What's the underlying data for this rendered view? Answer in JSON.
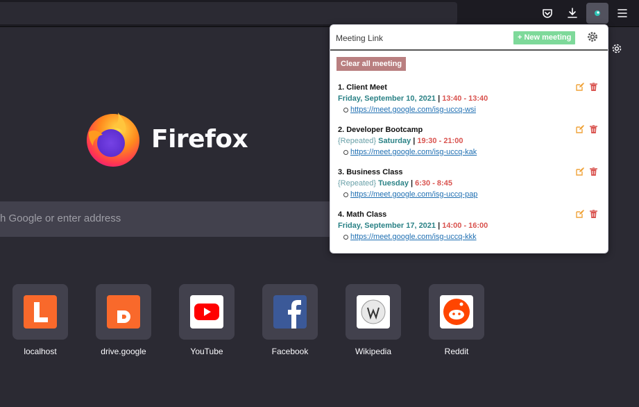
{
  "browser": {
    "search_placeholder": "h Google or enter address",
    "brand": "Firefox"
  },
  "tiles": [
    {
      "label": "localhost",
      "icon": "localhost-icon",
      "letter": "L",
      "color": "#f9692b"
    },
    {
      "label": "drive.google",
      "icon": "drive-google-icon",
      "letter": "D",
      "color": "#f9692b"
    },
    {
      "label": "YouTube",
      "icon": "youtube-icon",
      "color": "#ff0000"
    },
    {
      "label": "Facebook",
      "icon": "facebook-icon",
      "color": "#3b5998"
    },
    {
      "label": "Wikipedia",
      "icon": "wikipedia-icon",
      "color": "#eeeeee"
    },
    {
      "label": "Reddit",
      "icon": "reddit-icon",
      "color": "#ff4500"
    }
  ],
  "popup": {
    "title": "Meeting Link",
    "new_button": "+ New meeting",
    "clear_button": "Clear all meeting",
    "meetings": [
      {
        "title": "1. Client Meet",
        "repeated": "",
        "day": "Friday, September 10, 2021",
        "sep": "|",
        "time": "13:40 - 13:40",
        "link": "https://meet.google.com/isg-uccq-wsi"
      },
      {
        "title": "2. Developer Bootcamp",
        "repeated": "{Repeated}",
        "day": "Saturday",
        "sep": "|",
        "time": "19:30 - 21:00",
        "link": "https://meet.google.com/isg-uccq-kak"
      },
      {
        "title": "3. Business Class",
        "repeated": "{Repeated}",
        "day": "Tuesday",
        "sep": "|",
        "time": "6:30 - 8:45",
        "link": "https://meet.google.com/isg-uccq-pap"
      },
      {
        "title": "4. Math Class",
        "repeated": "",
        "day": "Friday, September 17, 2021",
        "sep": "|",
        "time": "14:00 - 16:00",
        "link": "https://meet.google.com/isg-uccq-kkk"
      }
    ]
  },
  "colors": {
    "accent_green": "#7ed99a",
    "clear_red": "#b97f80",
    "edit_orange": "#f0a33a",
    "delete_red": "#d9534f",
    "day_teal": "#2b8286",
    "time_red": "#d9534f"
  }
}
